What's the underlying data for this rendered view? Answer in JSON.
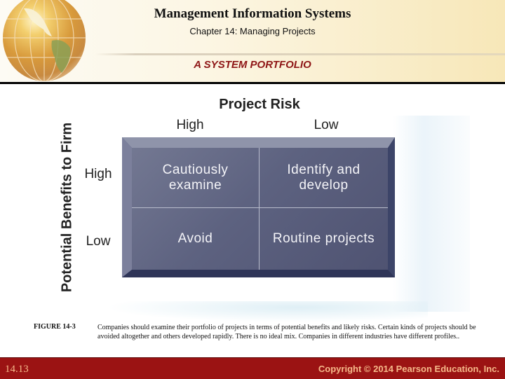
{
  "header": {
    "title": "Management Information Systems",
    "subtitle": "Chapter 14: Managing Projects",
    "section_title": "A SYSTEM PORTFOLIO",
    "logo_icon": "globe-icon"
  },
  "diagram": {
    "title": "Project Risk",
    "y_axis_label": "Potential Benefits to Firm",
    "columns": [
      "High",
      "Low"
    ],
    "rows": [
      "High",
      "Low"
    ],
    "cells": [
      [
        "Cautiously\nexamine",
        "Identify and\ndevelop"
      ],
      [
        "Avoid",
        "Routine projects"
      ]
    ]
  },
  "caption": {
    "label": "FIGURE 14-3",
    "text": "Companies should examine their portfolio of projects in terms of potential benefits and likely risks. Certain kinds of projects should be avoided altogether and others developed rapidly. There is no ideal mix. Companies in different industries have different profiles.."
  },
  "footer": {
    "slide_number": "14.13",
    "copyright": "Copyright © 2014 Pearson Education, Inc."
  },
  "colors": {
    "accent": "#8e1616",
    "footer_bg": "#9b1313",
    "footer_text": "#f6b98a",
    "matrix": "#4b5070"
  }
}
